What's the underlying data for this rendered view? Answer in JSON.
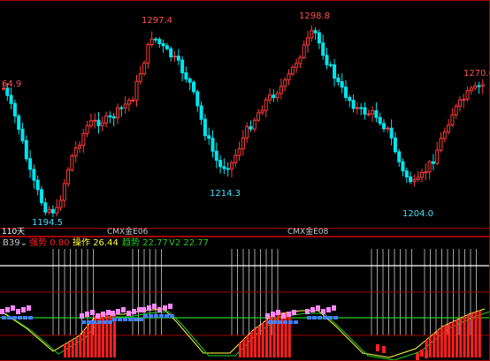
{
  "colors": {
    "up": "#ff3b3b",
    "down": "#00e5ee",
    "frame": "#a00000",
    "ma_white": "#ffffff",
    "hi_label": "#ff5050",
    "lo_label": "#40e0ff",
    "ind_grey": "#c8c8c8",
    "ind_red": "#ff2020",
    "ind_yellow": "#ffff40",
    "ind_green": "#20d020",
    "ind_pink": "#ff88ff",
    "ind_blue": "#4080ff"
  },
  "price_labels": {
    "left_cut": "64.9",
    "peak1": "1297.4",
    "peak2": "1298.8",
    "last": "1270.0",
    "low1": "1194.5",
    "low2": "1214.3",
    "low3": "1204.0"
  },
  "bottom_axis": {
    "period": "110天",
    "marker1": "CMX金E06",
    "marker2": "CMX金E08"
  },
  "indicator": {
    "name": "B39",
    "items": [
      {
        "label": "强势",
        "value": "0.80"
      },
      {
        "label": "操作",
        "value": "26.44"
      },
      {
        "label": "趋势",
        "value": "22.77"
      },
      {
        "label": "V2",
        "value": "22.77"
      }
    ]
  }
}
